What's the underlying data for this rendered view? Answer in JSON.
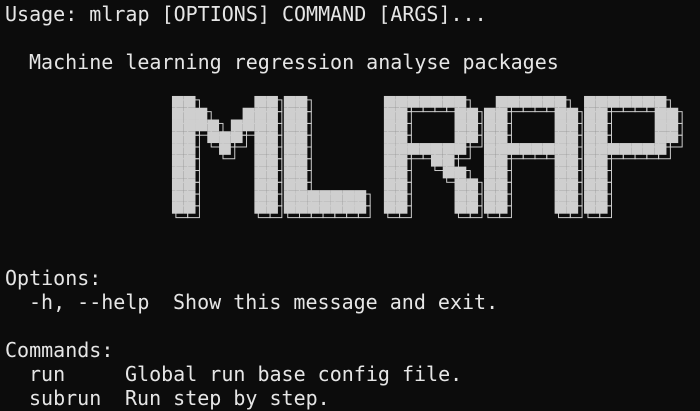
{
  "terminal": {
    "usage": "Usage: mlrap [OPTIONS] COMMAND [ARGS]...",
    "description": "Machine learning regression analyse packages",
    "banner_text": "MLRAP",
    "options_heading": "Options:",
    "options": [
      {
        "flag": "-h, --help",
        "help": "Show this message and exit."
      }
    ],
    "commands_heading": "Commands:",
    "commands": [
      {
        "name": "run",
        "help": "Global run base config file."
      },
      {
        "name": "subrun",
        "help": "Run step by step."
      }
    ]
  },
  "colors": {
    "background": "#0c0c0c",
    "text": "#e6e6e6",
    "banner_fill": "#cfcfcf"
  }
}
